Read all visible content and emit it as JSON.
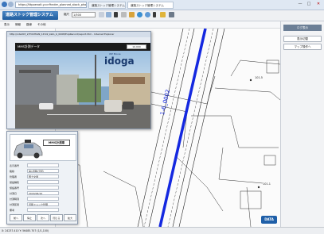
{
  "browser": {
    "address": "https://ittpoenait.y.ccrfhnder_planned_stock_photo.htm",
    "tabs": [
      "道路ストック管理システム",
      "道路ストック管理システム"
    ],
    "controls": [
      "—",
      "□",
      "✕"
    ]
  },
  "app": {
    "title": "道路ストック管理システム",
    "scale_label": "縮尺",
    "scale_value": "1/500",
    "menu": [
      "表示",
      "情報",
      "路線",
      "その他"
    ]
  },
  "map": {
    "route_label": "1-6_0002",
    "point_labels": [
      "101.5",
      "101.1"
    ],
    "logo_text": "DATA"
  },
  "right_panel": {
    "header": "ログ表示",
    "buttons": [
      "表示切替",
      "マップ操作へ"
    ]
  },
  "video": {
    "window_title": "http://ndsd03_2/TOCHIAN_1P-02_kato_b_0008/ExpRecord/report.htm - Internet Explorer",
    "header": "MMS計測データ",
    "frame_number": "10.000",
    "brand_main": "idoga",
    "brand_sub": "WP Movie"
  },
  "vehicle": {
    "title": "MMS計測車",
    "fields": [
      {
        "label": "表示番号",
        "value": ""
      },
      {
        "label": "路線",
        "value": "第1道路(元町)"
      },
      {
        "label": "管理者",
        "value": "国土交通"
      },
      {
        "label": "施設種別",
        "value": ""
      },
      {
        "label": "施設番号",
        "value": ""
      },
      {
        "label": "計測日",
        "value": "2016/06/10"
      },
      {
        "label": "計測時刻",
        "value": ""
      },
      {
        "label": "計測区間",
        "value": "道路ストック管理"
      },
      {
        "label": "備考",
        "value": ""
      }
    ],
    "buttons": [
      "前へ",
      "停止",
      "次へ",
      "閉じる",
      "拡大"
    ]
  },
  "status": {
    "text": "X: 24237.410 Y: 56485.707 (1/1,100)"
  }
}
